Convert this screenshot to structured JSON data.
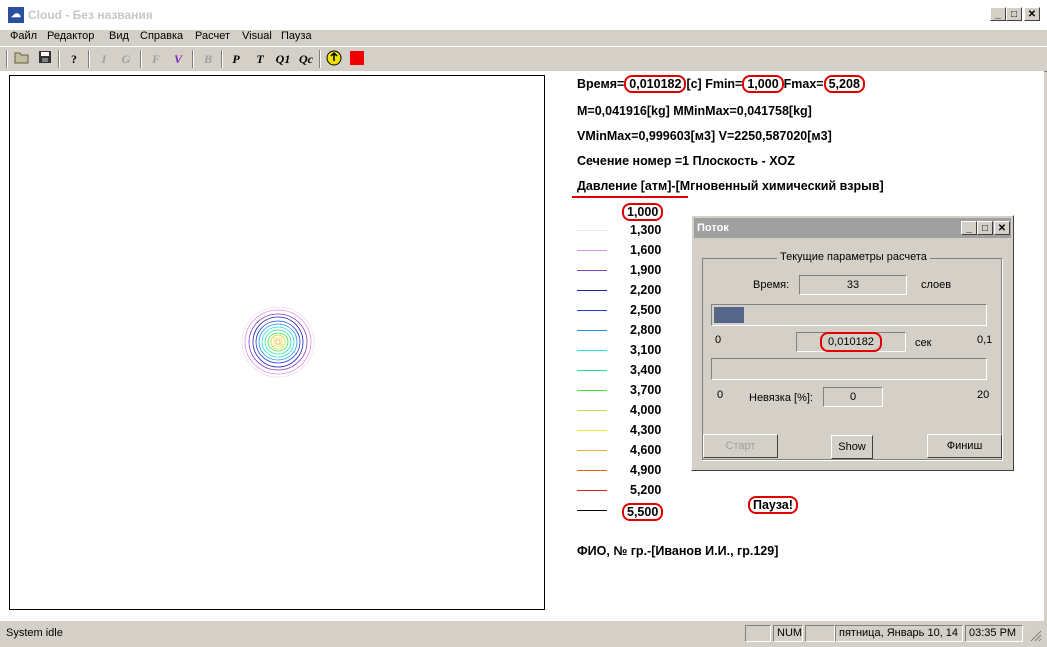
{
  "window": {
    "title": "Cloud - Без названия",
    "icon": "app-cloud-icon"
  },
  "menu": [
    "Файл",
    "Редактор",
    "Вид",
    "Справка",
    "Расчет",
    "Visual",
    "Пауза"
  ],
  "toolbar": {
    "p": "P",
    "t": "T",
    "q1": "Q1",
    "qc": "Qc",
    "i": "I",
    "g": "G",
    "f": "F",
    "v": "V",
    "b": "B"
  },
  "info": {
    "time_label": "Время=",
    "time_value": "0,010182",
    "time_unit": "[c] Fmin=",
    "fmin_value": "1,000",
    "fmax_label": "Fmax=",
    "fmax_value": "5,208",
    "mass_line": "M=0,041916[kg] MMinMax=0,041758[kg]",
    "volume_line": "VMinMax=0,999603[м3] V=2250,587020[м3]",
    "section_line": "Сечение номер =1   Плоскость - XOZ",
    "pressure_label": "Давление [атм]",
    "pressure_desc": "-[Мгновенный химический взрыв]",
    "pause": "Пауза!",
    "student": "ФИО, № гр.-[Иванов И.И., гр.129]"
  },
  "legend": [
    {
      "value": "1,000",
      "color": "#ffffff"
    },
    {
      "value": "1,300",
      "color": "#f0e0f0"
    },
    {
      "value": "1,600",
      "color": "#e090e0"
    },
    {
      "value": "1,900",
      "color": "#8040c0"
    },
    {
      "value": "2,200",
      "color": "#2020a0"
    },
    {
      "value": "2,500",
      "color": "#2040e0"
    },
    {
      "value": "2,800",
      "color": "#2090e0"
    },
    {
      "value": "3,100",
      "color": "#20e0e0"
    },
    {
      "value": "3,400",
      "color": "#20e0a0"
    },
    {
      "value": "3,700",
      "color": "#40e040"
    },
    {
      "value": "4,000",
      "color": "#c0e040"
    },
    {
      "value": "4,300",
      "color": "#f0e040"
    },
    {
      "value": "4,600",
      "color": "#f0b040"
    },
    {
      "value": "4,900",
      "color": "#e06020"
    },
    {
      "value": "5,200",
      "color": "#e02020"
    },
    {
      "value": "5,500",
      "color": "#000000"
    }
  ],
  "dialog": {
    "title": "Поток",
    "group_label": "Текущие параметры расчета",
    "time_label": "Время:",
    "layers_value": "33",
    "layers_unit": "слоев",
    "progress1_fraction": 0.11,
    "min1": "0",
    "time_value": "0,010182",
    "sec_unit": "сек",
    "max1": "0,1",
    "min2": "0",
    "residual_label": "Невязка [%]:",
    "residual_value": "0",
    "max2": "20",
    "start_button": "Старт",
    "show_button": "Show",
    "finish_button": "Финиш"
  },
  "status": {
    "text": "System idle",
    "num": "NUM",
    "date": "пятница, Январь 10, 14",
    "time": "03:35 PM"
  }
}
